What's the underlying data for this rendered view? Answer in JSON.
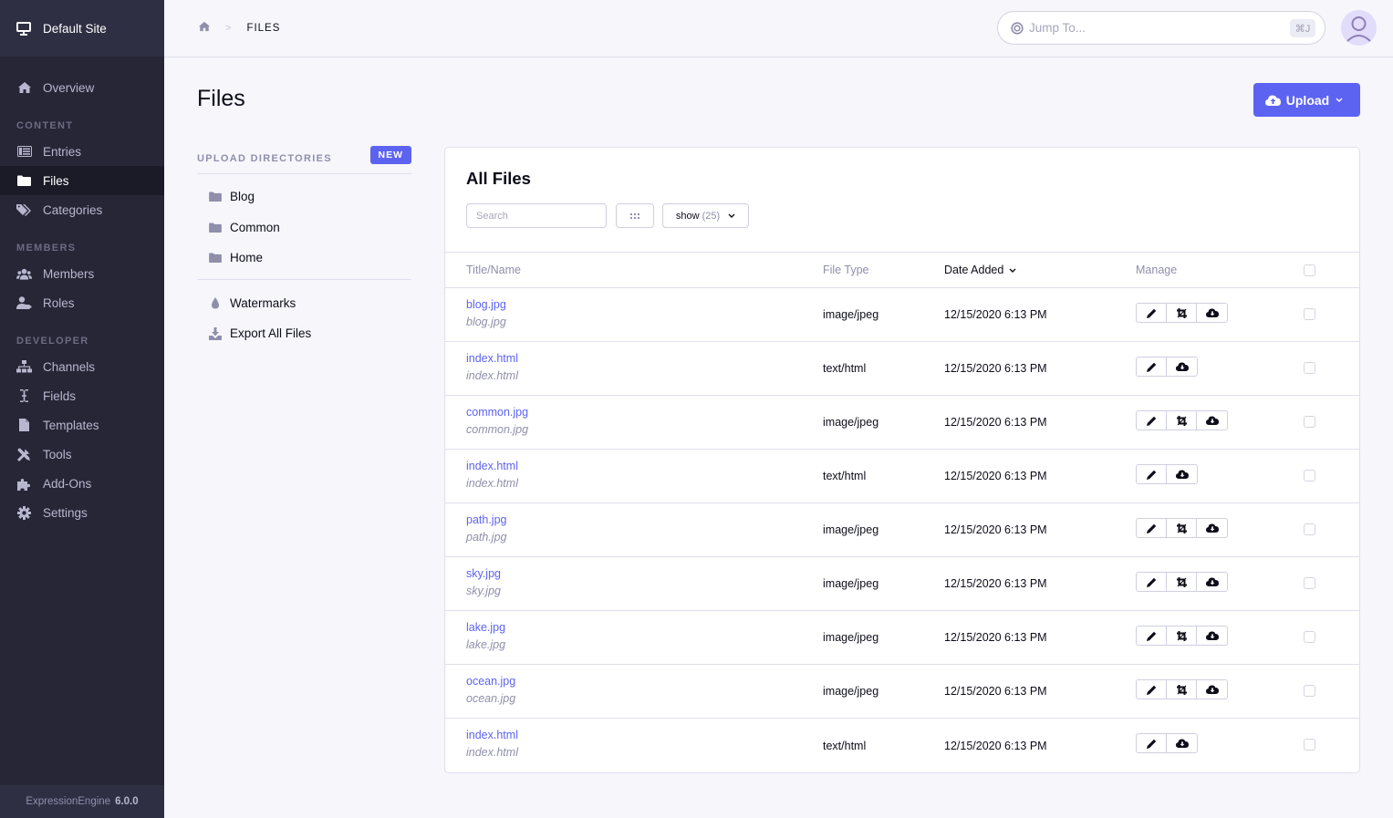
{
  "sidebar": {
    "site_name": "Default Site",
    "overview_label": "Overview",
    "sections": {
      "content": "CONTENT",
      "members": "MEMBERS",
      "developer": "DEVELOPER"
    },
    "content_items": [
      {
        "label": "Entries",
        "icon": "entries-icon"
      },
      {
        "label": "Files",
        "icon": "folder-icon",
        "active": true
      },
      {
        "label": "Categories",
        "icon": "tags-icon"
      }
    ],
    "member_items": [
      {
        "label": "Members",
        "icon": "users-icon"
      },
      {
        "label": "Roles",
        "icon": "user-tag-icon"
      }
    ],
    "developer_items": [
      {
        "label": "Channels",
        "icon": "sitemap-icon"
      },
      {
        "label": "Fields",
        "icon": "text-cursor-icon"
      },
      {
        "label": "Templates",
        "icon": "file-icon"
      },
      {
        "label": "Tools",
        "icon": "tools-icon"
      },
      {
        "label": "Add-Ons",
        "icon": "puzzle-icon"
      },
      {
        "label": "Settings",
        "icon": "gear-icon"
      }
    ],
    "footer": {
      "product": "ExpressionEngine",
      "version": "6.0.0"
    }
  },
  "topbar": {
    "breadcrumb_sep": ">",
    "breadcrumb_current": "FILES",
    "jump_placeholder": "Jump To...",
    "jump_shortcut": "⌘J"
  },
  "page": {
    "title": "Files",
    "upload_label": "Upload"
  },
  "directories": {
    "heading": "UPLOAD DIRECTORIES",
    "new_label": "NEW",
    "items": [
      "Blog",
      "Common",
      "Home"
    ],
    "tools": [
      {
        "label": "Watermarks",
        "icon": "droplet-icon"
      },
      {
        "label": "Export All Files",
        "icon": "download-icon"
      }
    ]
  },
  "files": {
    "title": "All Files",
    "search_placeholder": "Search",
    "show_label": "show",
    "show_count": "(25)",
    "columns": {
      "name": "Title/Name",
      "type": "File Type",
      "date": "Date Added",
      "manage": "Manage"
    },
    "rows": [
      {
        "title": "blog.jpg",
        "file": "blog.jpg",
        "type": "image/jpeg",
        "date": "12/15/2020 6:13 PM",
        "crop": true
      },
      {
        "title": "index.html",
        "file": "index.html",
        "type": "text/html",
        "date": "12/15/2020 6:13 PM",
        "crop": false
      },
      {
        "title": "common.jpg",
        "file": "common.jpg",
        "type": "image/jpeg",
        "date": "12/15/2020 6:13 PM",
        "crop": true
      },
      {
        "title": "index.html",
        "file": "index.html",
        "type": "text/html",
        "date": "12/15/2020 6:13 PM",
        "crop": false
      },
      {
        "title": "path.jpg",
        "file": "path.jpg",
        "type": "image/jpeg",
        "date": "12/15/2020 6:13 PM",
        "crop": true
      },
      {
        "title": "sky.jpg",
        "file": "sky.jpg",
        "type": "image/jpeg",
        "date": "12/15/2020 6:13 PM",
        "crop": true
      },
      {
        "title": "lake.jpg",
        "file": "lake.jpg",
        "type": "image/jpeg",
        "date": "12/15/2020 6:13 PM",
        "crop": true
      },
      {
        "title": "ocean.jpg",
        "file": "ocean.jpg",
        "type": "image/jpeg",
        "date": "12/15/2020 6:13 PM",
        "crop": true
      },
      {
        "title": "index.html",
        "file": "index.html",
        "type": "text/html",
        "date": "12/15/2020 6:13 PM",
        "crop": false
      }
    ]
  },
  "colors": {
    "accent": "#5d63f1",
    "sidebar_bg": "#262636",
    "sidebar_header_bg": "#2f2f44",
    "page_bg": "#f6f6fb"
  }
}
